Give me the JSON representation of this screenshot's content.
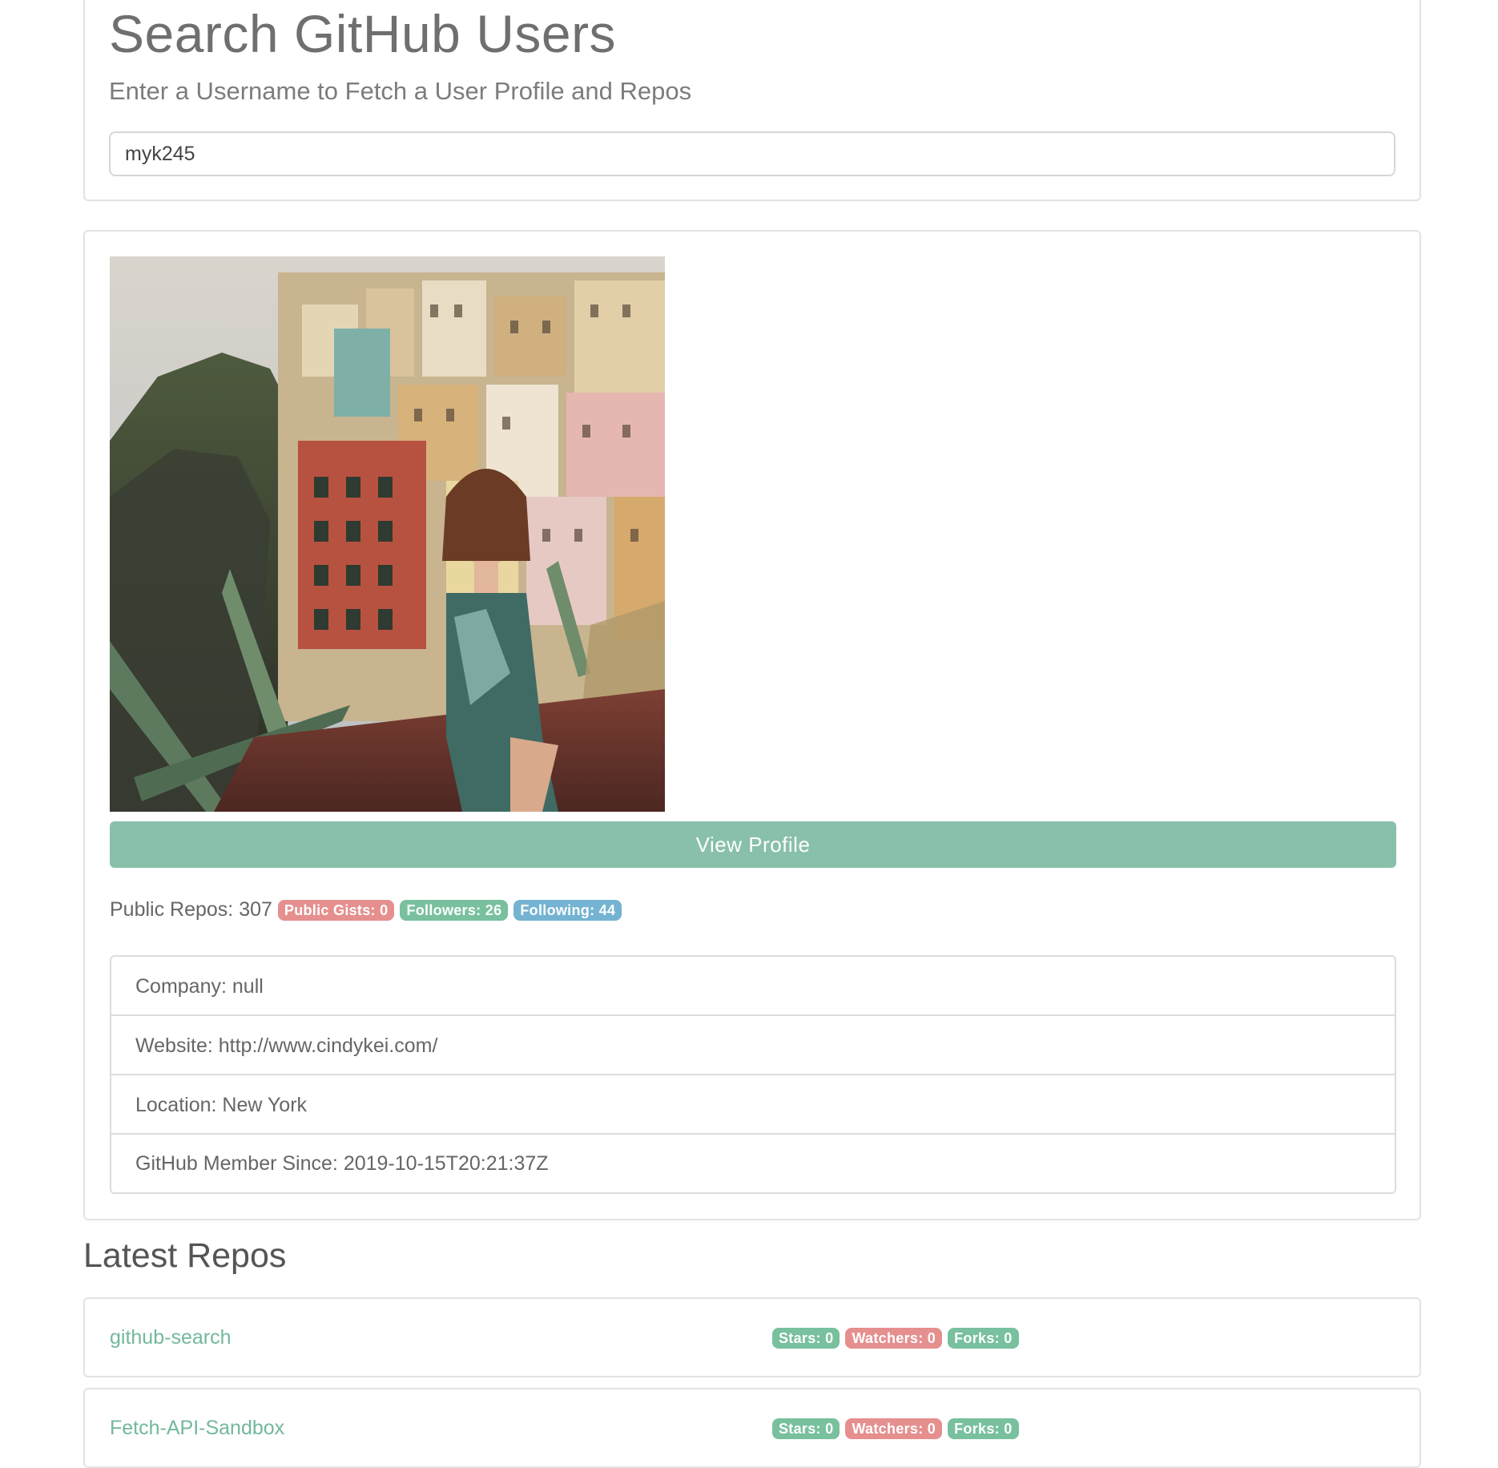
{
  "search": {
    "title": "Search GitHub Users",
    "subtitle": "Enter a Username to Fetch a User Profile and Repos",
    "input_value": "myk245"
  },
  "profile": {
    "avatar_alt": "avatar",
    "view_profile_label": "View Profile",
    "public_repos": "Public Repos: 307",
    "public_gists": "Public Gists: 0",
    "followers": "Followers: 26",
    "following": "Following: 44",
    "company": "Company: null",
    "website": "Website: http://www.cindykei.com/",
    "location": "Location: New York",
    "member_since": "GitHub Member Since: 2019-10-15T20:21:37Z"
  },
  "repos": {
    "title": "Latest Repos",
    "items": [
      {
        "name": "github-search",
        "stars": "Stars: 0",
        "watchers": "Watchers: 0",
        "forks": "Forks: 0"
      },
      {
        "name": "Fetch-API-Sandbox",
        "stars": "Stars: 0",
        "watchers": "Watchers: 0",
        "forks": "Forks: 0"
      }
    ]
  },
  "colors": {
    "accent_green": "#88c0aa",
    "badge_red": "#e58f8f",
    "badge_green": "#78c09e",
    "badge_blue": "#74b3d1",
    "link_green": "#74b89b"
  }
}
